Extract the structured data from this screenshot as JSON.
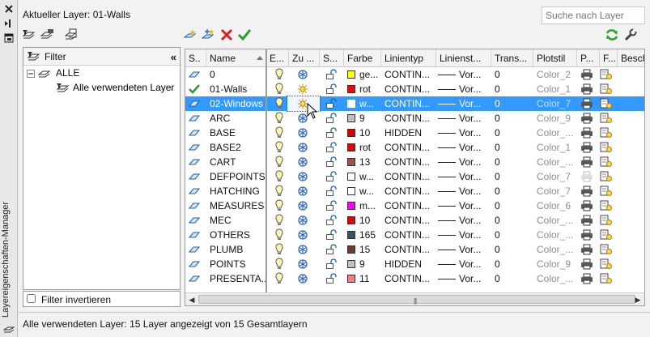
{
  "window": {
    "side_title": "Layereigenschaften-Manager",
    "current_layer_label": "Aktueller Layer: 01-Walls",
    "search_placeholder": "Suche nach Layer"
  },
  "filter_pane": {
    "header_label": "Filter",
    "tree": {
      "root": "ALLE",
      "child": "Alle verwendeten Layer"
    },
    "invert_label": "Filter invertieren"
  },
  "grid": {
    "columns": [
      "S..",
      "Name",
      "E...",
      "Zu ...",
      "S...",
      "Farbe",
      "Linientyp",
      "Linienst...",
      "Trans...",
      "Plotstil",
      "P...",
      "F...",
      "Besch"
    ],
    "rows": [
      {
        "status": "layer",
        "name": "0",
        "on": true,
        "freeze": "frozen",
        "color_hex": "#ffff00",
        "color_name": "ge...",
        "linetype": "CONTIN...",
        "lineweight": "Vor...",
        "transparency": "0",
        "plotstyle": "Color_2",
        "plot": true,
        "pale": false
      },
      {
        "status": "current",
        "name": "01-Walls",
        "on": true,
        "freeze": "thawed",
        "color_hex": "#ff0000",
        "color_name": "rot",
        "linetype": "CONTIN...",
        "lineweight": "Vor...",
        "transparency": "0",
        "plotstyle": "Color_1",
        "plot": true,
        "pale": false
      },
      {
        "status": "layer",
        "name": "02-Windows",
        "on": true,
        "freeze": "thawed",
        "color_hex": "#ffffff",
        "color_name": "w...",
        "linetype": "CONTIN...",
        "lineweight": "Vor...",
        "transparency": "0",
        "plotstyle": "Color_7",
        "plot": true,
        "pale": false,
        "selected": true
      },
      {
        "status": "layer",
        "name": "ARC",
        "on": true,
        "freeze": "frozen",
        "color_hex": "#c0c0c0",
        "color_name": "9",
        "linetype": "CONTIN...",
        "lineweight": "Vor...",
        "transparency": "0",
        "plotstyle": "Color_9",
        "plot": true,
        "pale": false
      },
      {
        "status": "layer",
        "name": "BASE",
        "on": true,
        "freeze": "frozen",
        "color_hex": "#e00000",
        "color_name": "10",
        "linetype": "HIDDEN",
        "lineweight": "Vor...",
        "transparency": "0",
        "plotstyle": "Color_...",
        "plot": true,
        "pale": false
      },
      {
        "status": "layer",
        "name": "BASE2",
        "on": true,
        "freeze": "frozen",
        "color_hex": "#e00000",
        "color_name": "rot",
        "linetype": "CONTIN...",
        "lineweight": "Vor...",
        "transparency": "0",
        "plotstyle": "Color_1",
        "plot": true,
        "pale": false
      },
      {
        "status": "layer",
        "name": "CART",
        "on": true,
        "freeze": "frozen",
        "color_hex": "#a05050",
        "color_name": "13",
        "linetype": "CONTIN...",
        "lineweight": "Vor...",
        "transparency": "0",
        "plotstyle": "Color_...",
        "plot": true,
        "pale": false
      },
      {
        "status": "layer",
        "name": "DEFPOINTS",
        "on": true,
        "freeze": "frozen",
        "color_hex": "#ffffff",
        "color_name": "w...",
        "linetype": "CONTIN...",
        "lineweight": "Vor...",
        "transparency": "0",
        "plotstyle": "Color_7",
        "plot": false,
        "pale": true
      },
      {
        "status": "layer",
        "name": "HATCHING",
        "on": true,
        "freeze": "frozen",
        "color_hex": "#ffffff",
        "color_name": "w...",
        "linetype": "CONTIN...",
        "lineweight": "Vor...",
        "transparency": "0",
        "plotstyle": "Color_7",
        "plot": true,
        "pale": false
      },
      {
        "status": "layer",
        "name": "MEASURES",
        "on": true,
        "freeze": "frozen",
        "color_hex": "#ff00ff",
        "color_name": "m...",
        "linetype": "CONTIN...",
        "lineweight": "Vor...",
        "transparency": "0",
        "plotstyle": "Color_6",
        "plot": true,
        "pale": false
      },
      {
        "status": "layer",
        "name": "MEC",
        "on": true,
        "freeze": "frozen",
        "color_hex": "#e00000",
        "color_name": "10",
        "linetype": "CONTIN...",
        "lineweight": "Vor...",
        "transparency": "0",
        "plotstyle": "Color_...",
        "plot": true,
        "pale": false
      },
      {
        "status": "layer",
        "name": "OTHERS",
        "on": true,
        "freeze": "frozen",
        "color_hex": "#34506e",
        "color_name": "165",
        "linetype": "CONTIN...",
        "lineweight": "Vor...",
        "transparency": "0",
        "plotstyle": "Color_...",
        "plot": true,
        "pale": false
      },
      {
        "status": "layer",
        "name": "PLUMB",
        "on": true,
        "freeze": "frozen",
        "color_hex": "#6e3a2a",
        "color_name": "15",
        "linetype": "CONTIN...",
        "lineweight": "Vor...",
        "transparency": "0",
        "plotstyle": "Color_...",
        "plot": true,
        "pale": false
      },
      {
        "status": "layer",
        "name": "POINTS",
        "on": true,
        "freeze": "frozen",
        "color_hex": "#c0c0c0",
        "color_name": "9",
        "linetype": "HIDDEN",
        "lineweight": "Vor...",
        "transparency": "0",
        "plotstyle": "Color_9",
        "plot": true,
        "pale": false
      },
      {
        "status": "layer",
        "name": "PRESENTA...",
        "on": true,
        "freeze": "frozen",
        "color_hex": "#f08080",
        "color_name": "11",
        "linetype": "CONTIN...",
        "lineweight": "Vor...",
        "transparency": "0",
        "plotstyle": "Color_...",
        "plot": true,
        "pale": false
      }
    ]
  },
  "status_bar": {
    "text": "Alle verwendeten Layer: 15 Layer angezeigt von 15 Gesamtlayern"
  },
  "colors": {
    "selection": "#3399ff",
    "current_check": "#2e9b2e",
    "delete_x": "#d62222",
    "refresh": "#2aa12a"
  }
}
